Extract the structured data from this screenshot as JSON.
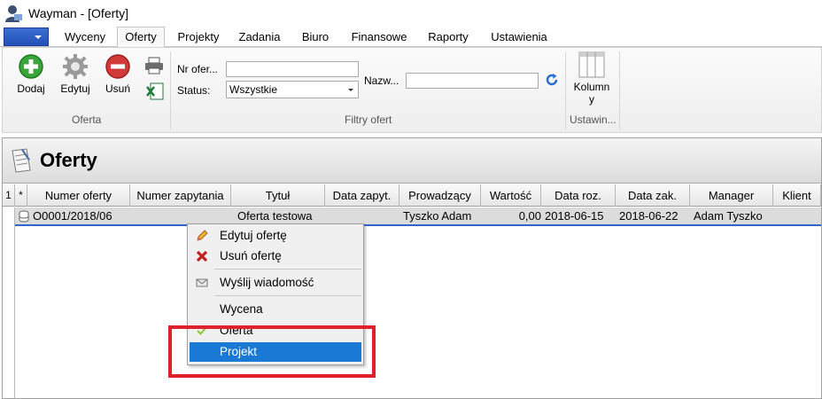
{
  "window": {
    "title": "Wayman - [Oferty]"
  },
  "tabs": [
    {
      "label": "Wyceny"
    },
    {
      "label": "Oferty"
    },
    {
      "label": "Projekty"
    },
    {
      "label": "Zadania"
    },
    {
      "label": "Biuro"
    },
    {
      "label": "Finansowe"
    },
    {
      "label": "Raporty"
    },
    {
      "label": "Ustawienia"
    }
  ],
  "ribbon": {
    "oferta_group": {
      "label": "Oferta",
      "add": "Dodaj",
      "edit": "Edytuj",
      "delete": "Usuń"
    },
    "filters_group": {
      "label": "Filtry ofert",
      "nr_label": "Nr ofer...",
      "nr_value": "",
      "status_label": "Status:",
      "status_value": "Wszystkie",
      "name_label": "Nazw...",
      "name_value": ""
    },
    "columns_group": {
      "label": "Ustawin...",
      "button_line1": "Kolumn",
      "button_line2": "y"
    }
  },
  "panel": {
    "title": "Oferty"
  },
  "grid": {
    "row_indicator": "1",
    "star": "*",
    "columns": [
      "Numer oferty",
      "Numer zapytania",
      "Tytuł",
      "Data zapyt.",
      "Prowadzący",
      "Wartość",
      "Data roz.",
      "Data zak.",
      "Manager",
      "Klient"
    ],
    "rows": [
      {
        "numer_oferty": "O0001/2018/06",
        "numer_zapytania": "",
        "tytul": "Oferta testowa",
        "data_zapyt": "",
        "prowadzacy": "Tyszko Adam",
        "wartosc": "0,00",
        "data_roz": "2018-06-15",
        "data_zak": "2018-06-22",
        "manager": "Adam Tyszko",
        "klient": ""
      }
    ]
  },
  "context_menu": {
    "items": [
      {
        "label": "Edytuj ofertę",
        "icon": "pencil-icon"
      },
      {
        "label": "Usuń ofertę",
        "icon": "red-x-icon"
      },
      {
        "label": "Wyślij wiadomość",
        "icon": "envelope-icon"
      },
      {
        "label": "Wycena",
        "icon": ""
      },
      {
        "label": "Oferta",
        "icon": "checkmark-icon",
        "checked": true
      },
      {
        "label": "Projekt",
        "icon": "",
        "selected": true
      }
    ]
  },
  "colors": {
    "accent": "#1979d5",
    "highlight_box": "#e0202a",
    "row_border": "#3366cc"
  }
}
